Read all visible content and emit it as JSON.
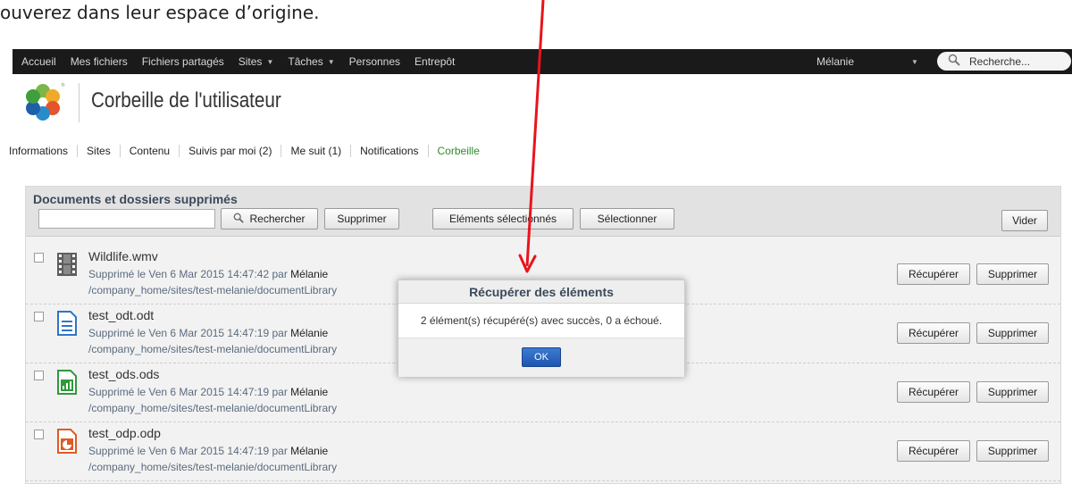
{
  "intro_text": "ouverez dans leur espace d’origine.",
  "topbar": {
    "nav": [
      "Accueil",
      "Mes fichiers",
      "Fichiers partagés",
      "Sites",
      "Tâches",
      "Personnes",
      "Entrepôt"
    ],
    "user": "Mélanie",
    "search_placeholder": "Recherche..."
  },
  "header": {
    "title": "Corbeille de l'utilisateur"
  },
  "tabs": [
    "Informations",
    "Sites",
    "Contenu",
    "Suivis par moi (2)",
    "Me suit (1)",
    "Notifications",
    "Corbeille"
  ],
  "panel": {
    "title": "Documents et dossiers supprimés",
    "filter_value": "",
    "search_button": "Rechercher",
    "delete_button": "Supprimer",
    "selected_items_button": "Eléments sélectionnés",
    "select_button": "Sélectionner",
    "empty_button": "Vider"
  },
  "rows": [
    {
      "name": "Wildlife.wmv",
      "icon": "video-file-icon",
      "deleted_label": "Supprimé le Ven 6 Mar 2015 14:47:42 par",
      "by": "Mélanie",
      "path": "/company_home/sites/test-melanie/documentLibrary",
      "restore": "Récupérer",
      "delete": "Supprimer"
    },
    {
      "name": "test_odt.odt",
      "icon": "text-document-icon",
      "deleted_label": "Supprimé le Ven 6 Mar 2015 14:47:19 par",
      "by": "Mélanie",
      "path": "/company_home/sites/test-melanie/documentLibrary",
      "restore": "Récupérer",
      "delete": "Supprimer"
    },
    {
      "name": "test_ods.ods",
      "icon": "spreadsheet-icon",
      "deleted_label": "Supprimé le Ven 6 Mar 2015 14:47:19 par",
      "by": "Mélanie",
      "path": "/company_home/sites/test-melanie/documentLibrary",
      "restore": "Récupérer",
      "delete": "Supprimer"
    },
    {
      "name": "test_odp.odp",
      "icon": "presentation-icon",
      "deleted_label": "Supprimé le Ven 6 Mar 2015 14:47:19 par",
      "by": "Mélanie",
      "path": "/company_home/sites/test-melanie/documentLibrary",
      "restore": "Récupérer",
      "delete": "Supprimer"
    }
  ],
  "dialog": {
    "title": "Récupérer des éléments",
    "message": "2 élément(s) récupéré(s) avec succès, 0 a échoué.",
    "ok": "OK"
  },
  "colors": {
    "topbar": "#1a1a1a",
    "active_tab": "#2e8b2e",
    "annotation_arrow": "#e8141c",
    "ok_button": "#2a63c2"
  }
}
